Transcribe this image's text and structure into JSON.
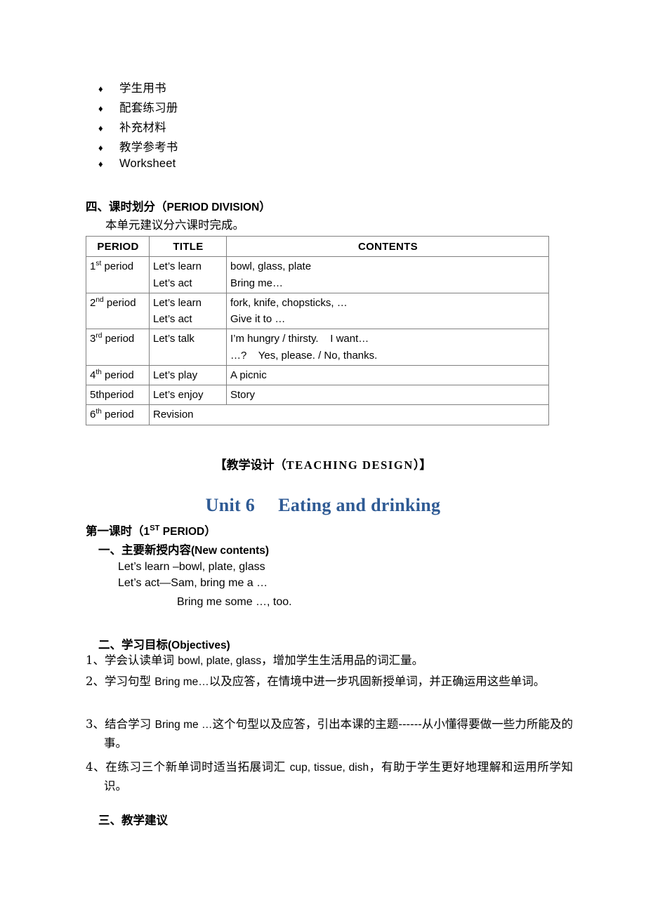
{
  "materials_list": {
    "bullet_glyph": "♦",
    "items": [
      {
        "text": "学生用书",
        "lang": "cn"
      },
      {
        "text": "配套练习册",
        "lang": "cn"
      },
      {
        "text": "补充材料",
        "lang": "cn"
      },
      {
        "text": "教学参考书",
        "lang": "cn"
      },
      {
        "text": "Worksheet",
        "lang": "en"
      }
    ]
  },
  "section_four": {
    "heading_cn": "四、课时划分（",
    "heading_en": "PERIOD DIVISION",
    "heading_close": "）",
    "intro": "本单元建议分六课时完成。"
  },
  "period_table": {
    "headers": [
      "PERIOD",
      "TITLE",
      "CONTENTS"
    ],
    "rows": [
      {
        "period_num": "1",
        "period_sup": "st",
        "period_suffix": " period",
        "titles": [
          "Let’s learn",
          "Let’s act"
        ],
        "contents": [
          "bowl, glass, plate",
          "Bring me…"
        ]
      },
      {
        "period_num": "2",
        "period_sup": "nd",
        "period_suffix": " period",
        "titles": [
          "Let’s learn",
          "Let’s act"
        ],
        "contents": [
          "fork, knife, chopsticks, …",
          "Give it to …"
        ]
      },
      {
        "period_num": "3",
        "period_sup": "rd",
        "period_suffix": " period",
        "titles": [
          "Let’s talk"
        ],
        "contents": [
          "I’m hungry / thirsty.    I want…",
          "…?    Yes, please. / No, thanks."
        ]
      },
      {
        "period_num": "4",
        "period_sup": "th",
        "period_suffix": " period",
        "titles": [
          "Let’s play"
        ],
        "contents": [
          "A picnic"
        ]
      },
      {
        "period_num": "5th",
        "period_sup": "",
        "period_suffix": "period",
        "titles": [
          "Let’s enjoy"
        ],
        "contents": [
          "Story"
        ]
      },
      {
        "period_num": "6",
        "period_sup": "th",
        "period_suffix": " period",
        "titles": [
          "Revision"
        ],
        "contents": [],
        "merged_title": true
      }
    ]
  },
  "teaching_design": {
    "bracket_open": "【",
    "cn": "教学设计",
    "paren_open": "（",
    "en": "TEACHING DESIGN",
    "paren_close": "）",
    "bracket_close": "】"
  },
  "unit_title": {
    "text": "Unit 6  Eating and drinking",
    "color": "#2E5A94"
  },
  "first_period_line": {
    "cn": "第一课时（",
    "num": "1",
    "sup": "ST",
    "en": " PERIOD",
    "close": "）"
  },
  "section_one": {
    "heading_cn": "一、主要新授内容",
    "heading_en": "(New contents)",
    "lines": [
      "Let’s learn –bowl, plate, glass",
      "Let’s act—Sam, bring me a …",
      "Bring me some …, too."
    ]
  },
  "section_two": {
    "heading_cn": "二、学习目标",
    "heading_en": "(Objectives)",
    "objectives": [
      {
        "num": "1、",
        "parts": [
          {
            "t": "学会认读单词 ",
            "k": "cn"
          },
          {
            "t": "bowl, plate, glass",
            "k": "en"
          },
          {
            "t": "，增加学生生活用品的词汇量。",
            "k": "cn"
          }
        ]
      },
      {
        "num": "2、",
        "parts": [
          {
            "t": "学习句型 ",
            "k": "cn"
          },
          {
            "t": "Bring  me…",
            "k": "en"
          },
          {
            "t": "以及应答，在情境中进一步巩固新授单词，并正确运用这些单词。",
            "k": "cn"
          }
        ]
      },
      {
        "num": "3、",
        "parts": [
          {
            "t": "结合学习 ",
            "k": "cn"
          },
          {
            "t": "Bring me …",
            "k": "en"
          },
          {
            "t": "这个句型以及应答，引出本课的主题------从小懂得要做一些力所能及的事。",
            "k": "cn"
          }
        ]
      },
      {
        "num": "4、",
        "parts": [
          {
            "t": "在练习三个新单词时适当拓展词汇 ",
            "k": "cn"
          },
          {
            "t": "cup, tissue, dish",
            "k": "en"
          },
          {
            "t": "，有助于学生更好地理解和运用所学知识。",
            "k": "cn"
          }
        ]
      }
    ]
  },
  "section_three": {
    "heading_cn": "三、教学建议"
  }
}
